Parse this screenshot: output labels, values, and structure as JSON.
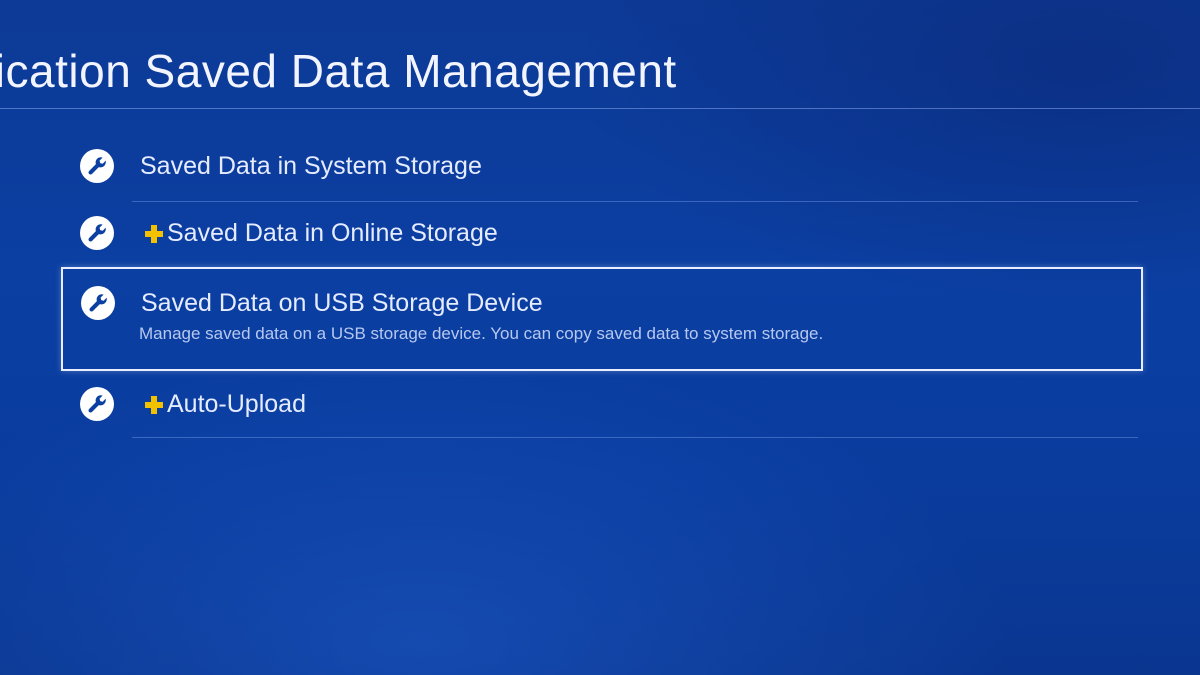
{
  "header": {
    "title": "plication Saved Data Management"
  },
  "menu": {
    "items": [
      {
        "label": "Saved Data in System Storage",
        "icon": "wrench-icon",
        "plus": false,
        "selected": false
      },
      {
        "label": "Saved Data in Online Storage",
        "icon": "wrench-icon",
        "plus": true,
        "selected": false
      },
      {
        "label": "Saved Data on USB Storage Device",
        "description": "Manage saved data on a USB storage device. You can copy saved data to system storage.",
        "icon": "wrench-icon",
        "plus": false,
        "selected": true
      },
      {
        "label": "Auto-Upload",
        "icon": "wrench-icon",
        "plus": true,
        "selected": false
      }
    ]
  },
  "colors": {
    "background": "#0b3fa2",
    "plus_badge": "#f2c200",
    "icon_fill": "#ffffff",
    "icon_glyph": "#0b3fa2"
  }
}
